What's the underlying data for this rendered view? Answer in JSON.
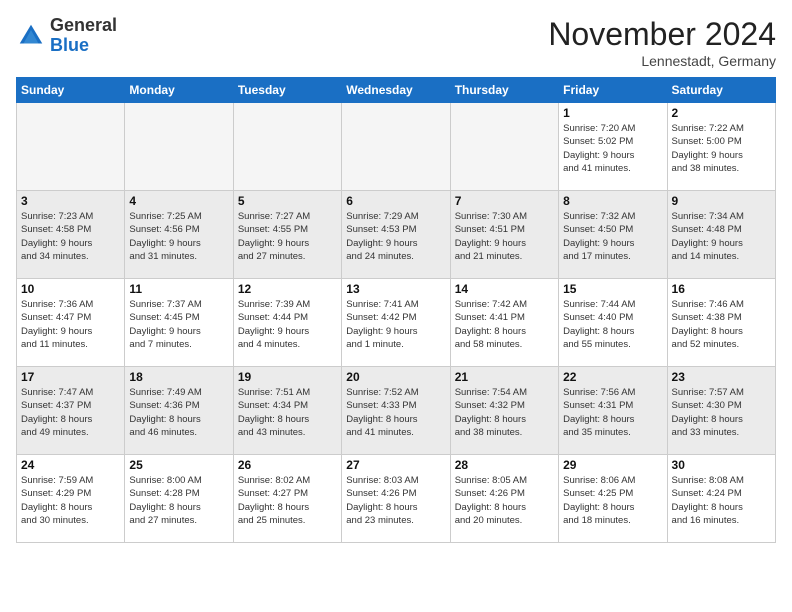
{
  "logo": {
    "general": "General",
    "blue": "Blue"
  },
  "title": "November 2024",
  "location": "Lennestadt, Germany",
  "days_of_week": [
    "Sunday",
    "Monday",
    "Tuesday",
    "Wednesday",
    "Thursday",
    "Friday",
    "Saturday"
  ],
  "weeks": [
    {
      "shade": "light",
      "days": [
        {
          "num": "",
          "info": "",
          "empty": true
        },
        {
          "num": "",
          "info": "",
          "empty": true
        },
        {
          "num": "",
          "info": "",
          "empty": true
        },
        {
          "num": "",
          "info": "",
          "empty": true
        },
        {
          "num": "",
          "info": "",
          "empty": true
        },
        {
          "num": "1",
          "info": "Sunrise: 7:20 AM\nSunset: 5:02 PM\nDaylight: 9 hours\nand 41 minutes."
        },
        {
          "num": "2",
          "info": "Sunrise: 7:22 AM\nSunset: 5:00 PM\nDaylight: 9 hours\nand 38 minutes."
        }
      ]
    },
    {
      "shade": "dark",
      "days": [
        {
          "num": "3",
          "info": "Sunrise: 7:23 AM\nSunset: 4:58 PM\nDaylight: 9 hours\nand 34 minutes."
        },
        {
          "num": "4",
          "info": "Sunrise: 7:25 AM\nSunset: 4:56 PM\nDaylight: 9 hours\nand 31 minutes."
        },
        {
          "num": "5",
          "info": "Sunrise: 7:27 AM\nSunset: 4:55 PM\nDaylight: 9 hours\nand 27 minutes."
        },
        {
          "num": "6",
          "info": "Sunrise: 7:29 AM\nSunset: 4:53 PM\nDaylight: 9 hours\nand 24 minutes."
        },
        {
          "num": "7",
          "info": "Sunrise: 7:30 AM\nSunset: 4:51 PM\nDaylight: 9 hours\nand 21 minutes."
        },
        {
          "num": "8",
          "info": "Sunrise: 7:32 AM\nSunset: 4:50 PM\nDaylight: 9 hours\nand 17 minutes."
        },
        {
          "num": "9",
          "info": "Sunrise: 7:34 AM\nSunset: 4:48 PM\nDaylight: 9 hours\nand 14 minutes."
        }
      ]
    },
    {
      "shade": "light",
      "days": [
        {
          "num": "10",
          "info": "Sunrise: 7:36 AM\nSunset: 4:47 PM\nDaylight: 9 hours\nand 11 minutes."
        },
        {
          "num": "11",
          "info": "Sunrise: 7:37 AM\nSunset: 4:45 PM\nDaylight: 9 hours\nand 7 minutes."
        },
        {
          "num": "12",
          "info": "Sunrise: 7:39 AM\nSunset: 4:44 PM\nDaylight: 9 hours\nand 4 minutes."
        },
        {
          "num": "13",
          "info": "Sunrise: 7:41 AM\nSunset: 4:42 PM\nDaylight: 9 hours\nand 1 minute."
        },
        {
          "num": "14",
          "info": "Sunrise: 7:42 AM\nSunset: 4:41 PM\nDaylight: 8 hours\nand 58 minutes."
        },
        {
          "num": "15",
          "info": "Sunrise: 7:44 AM\nSunset: 4:40 PM\nDaylight: 8 hours\nand 55 minutes."
        },
        {
          "num": "16",
          "info": "Sunrise: 7:46 AM\nSunset: 4:38 PM\nDaylight: 8 hours\nand 52 minutes."
        }
      ]
    },
    {
      "shade": "dark",
      "days": [
        {
          "num": "17",
          "info": "Sunrise: 7:47 AM\nSunset: 4:37 PM\nDaylight: 8 hours\nand 49 minutes."
        },
        {
          "num": "18",
          "info": "Sunrise: 7:49 AM\nSunset: 4:36 PM\nDaylight: 8 hours\nand 46 minutes."
        },
        {
          "num": "19",
          "info": "Sunrise: 7:51 AM\nSunset: 4:34 PM\nDaylight: 8 hours\nand 43 minutes."
        },
        {
          "num": "20",
          "info": "Sunrise: 7:52 AM\nSunset: 4:33 PM\nDaylight: 8 hours\nand 41 minutes."
        },
        {
          "num": "21",
          "info": "Sunrise: 7:54 AM\nSunset: 4:32 PM\nDaylight: 8 hours\nand 38 minutes."
        },
        {
          "num": "22",
          "info": "Sunrise: 7:56 AM\nSunset: 4:31 PM\nDaylight: 8 hours\nand 35 minutes."
        },
        {
          "num": "23",
          "info": "Sunrise: 7:57 AM\nSunset: 4:30 PM\nDaylight: 8 hours\nand 33 minutes."
        }
      ]
    },
    {
      "shade": "light",
      "days": [
        {
          "num": "24",
          "info": "Sunrise: 7:59 AM\nSunset: 4:29 PM\nDaylight: 8 hours\nand 30 minutes."
        },
        {
          "num": "25",
          "info": "Sunrise: 8:00 AM\nSunset: 4:28 PM\nDaylight: 8 hours\nand 27 minutes."
        },
        {
          "num": "26",
          "info": "Sunrise: 8:02 AM\nSunset: 4:27 PM\nDaylight: 8 hours\nand 25 minutes."
        },
        {
          "num": "27",
          "info": "Sunrise: 8:03 AM\nSunset: 4:26 PM\nDaylight: 8 hours\nand 23 minutes."
        },
        {
          "num": "28",
          "info": "Sunrise: 8:05 AM\nSunset: 4:26 PM\nDaylight: 8 hours\nand 20 minutes."
        },
        {
          "num": "29",
          "info": "Sunrise: 8:06 AM\nSunset: 4:25 PM\nDaylight: 8 hours\nand 18 minutes."
        },
        {
          "num": "30",
          "info": "Sunrise: 8:08 AM\nSunset: 4:24 PM\nDaylight: 8 hours\nand 16 minutes."
        }
      ]
    }
  ]
}
